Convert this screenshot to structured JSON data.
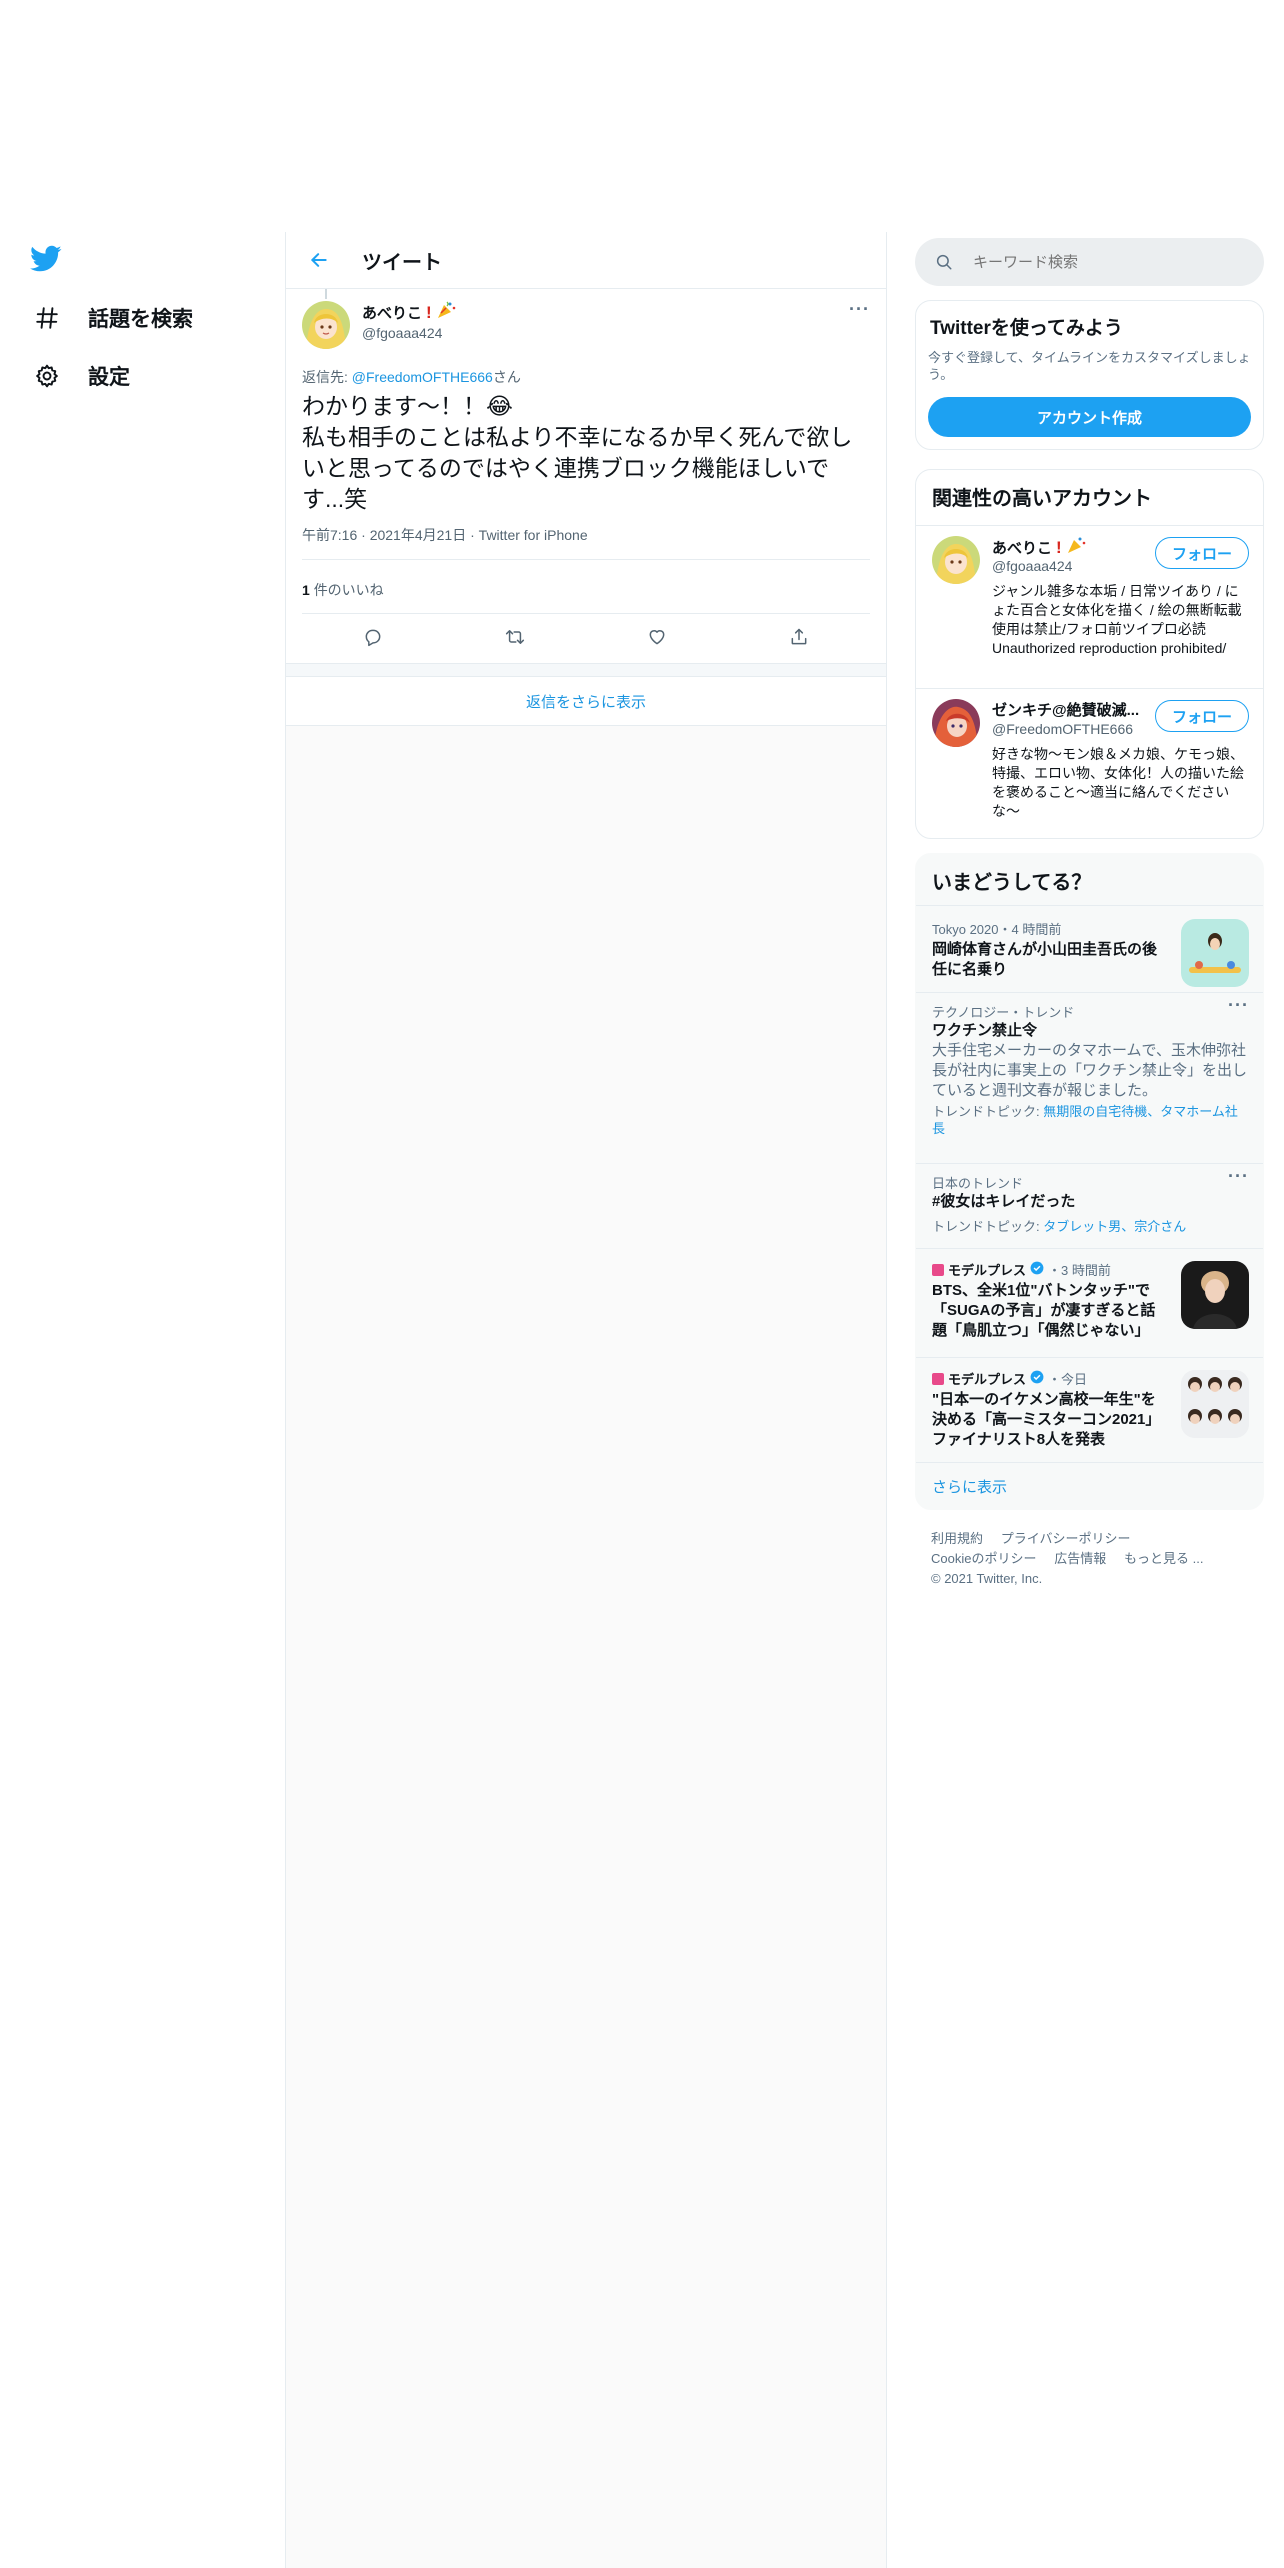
{
  "nav": {
    "logo": "twitter-bird-icon",
    "items": [
      {
        "label": "話題を検索",
        "icon": "hash-icon"
      },
      {
        "label": "設定",
        "icon": "gear-icon"
      }
    ]
  },
  "header": {
    "title": "ツイート"
  },
  "tweet": {
    "name": "あべりこ",
    "handle": "@fgoaaa424",
    "reply_prefix": "返信先:",
    "reply_to": "@FreedomOFTHE666",
    "reply_suffix": "さん",
    "text_line1": "わかります〜！！😂",
    "text_line2": "私も相手のことは私より不幸になるか早く死んで欲しいと思ってるのではやく連携ブロック機能ほしいです...笑",
    "time": "午前7:16",
    "date": "2021年4月21日",
    "source": "Twitter for iPhone",
    "likes_count": "1",
    "likes_label": "件のいいね",
    "show_more_replies": "返信をさらに表示"
  },
  "search": {
    "placeholder": "キーワード検索"
  },
  "signup": {
    "title": "Twitterを使ってみよう",
    "desc": "今すぐ登録して、タイムラインをカスタマイズしましょう。",
    "button": "アカウント作成"
  },
  "related": {
    "title": "関連性の高いアカウント",
    "accounts": [
      {
        "name": "あべりこ",
        "handle": "@fgoaaa424",
        "follow": "フォロー",
        "bio": "ジャンル雑多な本垢 / 日常ツイあり / にょた百合と女体化を描く / 絵の無断転載使用は禁止/フォロ前ツイプロ必読Unauthorized reproduction prohibited/"
      },
      {
        "name": "ゼンキチ@絶賛破滅...",
        "handle": "@FreedomOFTHE666",
        "follow": "フォロー",
        "bio": "好きな物～モン娘＆メカ娘、ケモっ娘、特撮、エロい物、女体化！人の描いた絵を褒めること〜適当に絡んでくださいな〜"
      }
    ]
  },
  "trends": {
    "title": "いまどうしてる？",
    "items": [
      {
        "context": "Tokyo 2020・4 時間前",
        "title": "岡崎体育さんが小山田圭吾氏の後任に名乗り"
      },
      {
        "context": "テクノロジー・トレンド",
        "title": "ワクチン禁止令",
        "desc": "大手住宅メーカーのタマホームで、玉木伸弥社長が社内に事実上の「ワクチン禁止令」を出していると週刊文春が報じました。",
        "topic_label": "トレンドトピック:",
        "topic": "無期限の自宅待機、タマホーム社長"
      },
      {
        "context": "日本のトレンド",
        "title": "#彼女はキレイだった",
        "topic_label": "トレンドトピック:",
        "topic": "タブレット男、宗介さん"
      },
      {
        "source": "モデルプレス",
        "time": "・3 時間前",
        "title": "BTS、全米1位\"バトンタッチ\"で「SUGAの予言」が凄すぎると話題「鳥肌立つ」「偶然じゃない」"
      },
      {
        "source": "モデルプレス",
        "time": "・今日",
        "title": "\"日本一のイケメン高校一年生\"を決める「高一ミスターコン2021」ファイナリスト8人を発表"
      }
    ],
    "show_more": "さらに表示"
  },
  "footer": {
    "links1": [
      "利用規約",
      "プライバシーポリシー"
    ],
    "links2": [
      "Cookieのポリシー",
      "広告情報",
      "もっと見る ..."
    ],
    "copyright": "© 2021 Twitter, Inc."
  },
  "colors": {
    "accent": "#1da1f2",
    "text": "#0f1419",
    "muted": "#536471"
  }
}
